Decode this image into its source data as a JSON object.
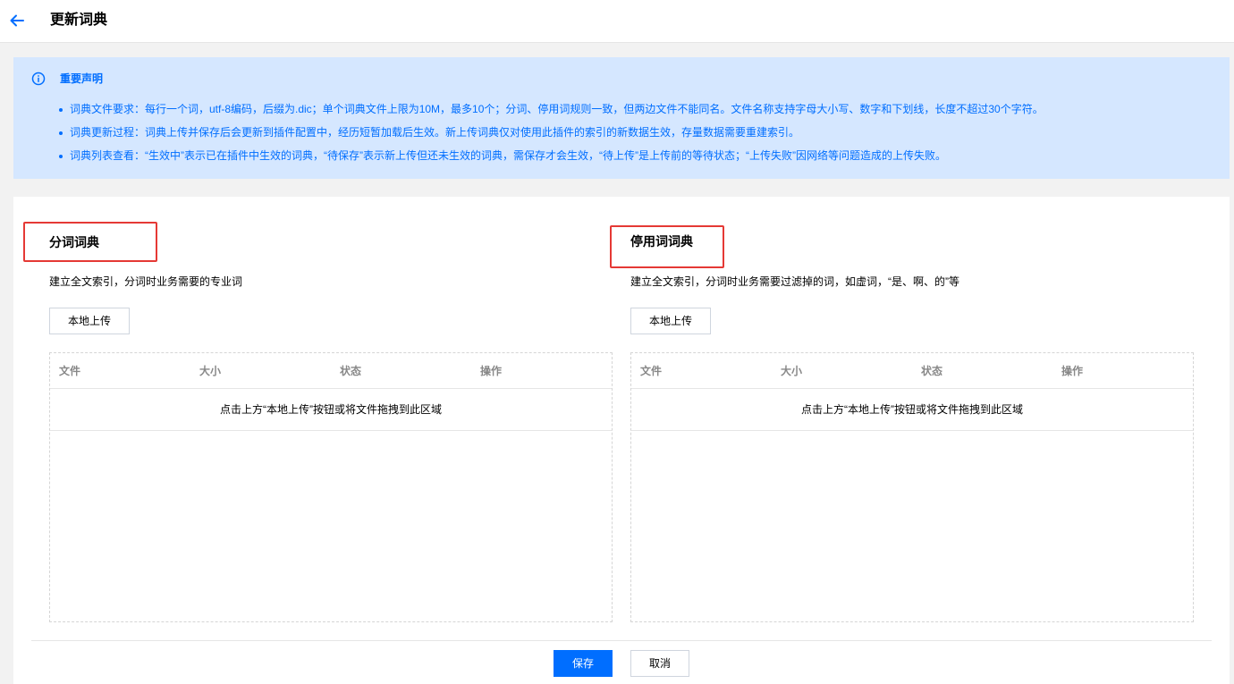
{
  "header": {
    "title": "更新词典",
    "back_icon": "arrow-left-icon",
    "accent_color": "#006eff"
  },
  "notice": {
    "icon": "info-circle-icon",
    "title": "重要声明",
    "items": [
      "词典文件要求：每行一个词，utf-8编码，后缀为.dic；单个词典文件上限为10M，最多10个；分词、停用词规则一致，但两边文件不能同名。文件名称支持字母大小写、数字和下划线，长度不超过30个字符。",
      "词典更新过程：词典上传并保存后会更新到插件配置中，经历短暂加载后生效。新上传词典仅对使用此插件的索引的新数据生效，存量数据需要重建索引。",
      "词典列表查看：“生效中”表示已在插件中生效的词典，“待保存”表示新上传但还未生效的词典，需保存才会生效，“待上传”是上传前的等待状态；“上传失败”因网络等问题造成的上传失败。"
    ],
    "background_color": "#d5e7ff"
  },
  "segmentation": {
    "title": "分词词典",
    "description": "建立全文索引，分词时业务需要的专业词",
    "upload_label": "本地上传",
    "columns": [
      "文件",
      "大小",
      "状态",
      "操作"
    ],
    "empty_text": "点击上方“本地上传”按钮或将文件拖拽到此区域"
  },
  "stopwords": {
    "title": "停用词词典",
    "description": "建立全文索引，分词时业务需要过滤掉的词，如虚词，“是、啊、的”等",
    "upload_label": "本地上传",
    "columns": [
      "文件",
      "大小",
      "状态",
      "操作"
    ],
    "empty_text": "点击上方“本地上传”按钮或将文件拖拽到此区域"
  },
  "footer": {
    "save_label": "保存",
    "cancel_label": "取消"
  },
  "highlight_color": "#e53935"
}
